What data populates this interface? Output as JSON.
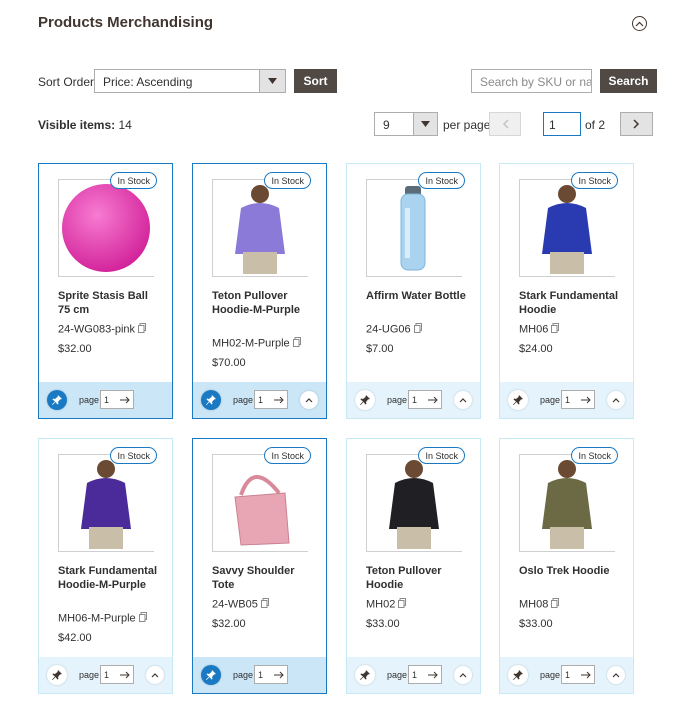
{
  "section": {
    "title": "Products Merchandising"
  },
  "sort": {
    "label": "Sort Order",
    "selected": "Price: Ascending",
    "button": "Sort"
  },
  "search": {
    "placeholder": "Search by SKU or name",
    "button": "Search"
  },
  "visible": {
    "label": "Visible items:",
    "count": "14"
  },
  "pager": {
    "per_page_value": "9",
    "per_page_label": "per page",
    "current": "1",
    "of_label": "of 2"
  },
  "colors": {
    "accent": "#1979c3",
    "dark_button": "#514943",
    "card_footer": "#e5f4fc"
  },
  "products": [
    {
      "stock": "In Stock",
      "name": "Sprite Stasis Ball 75 cm",
      "sku": "24-WG083-pink",
      "price": "$32.00",
      "page_label": "page",
      "page": "1",
      "image": "pink-yoga-ball"
    },
    {
      "stock": "In Stock",
      "name": "Teton Pullover Hoodie-M-Purple",
      "sku": "MH02-M-Purple",
      "price": "$70.00",
      "page_label": "page",
      "page": "1",
      "image": "purple-pullover"
    },
    {
      "stock": "In Stock",
      "name": "Affirm Water Bottle",
      "sku": "24-UG06",
      "price": "$7.00",
      "page_label": "page",
      "page": "1",
      "image": "water-bottle"
    },
    {
      "stock": "In Stock",
      "name": "Stark Fundamental Hoodie",
      "sku": "MH06",
      "price": "$24.00",
      "page_label": "page",
      "page": "1",
      "image": "blue-hoodie"
    },
    {
      "stock": "In Stock",
      "name": "Stark Fundamental Hoodie-M-Purple",
      "sku": "MH06-M-Purple",
      "price": "$42.00",
      "page_label": "page",
      "page": "1",
      "image": "purple-hoodie"
    },
    {
      "stock": "In Stock",
      "name": "Savvy Shoulder Tote",
      "sku": "24-WB05",
      "price": "$32.00",
      "page_label": "page",
      "page": "1",
      "image": "pink-tote"
    },
    {
      "stock": "In Stock",
      "name": "Teton Pullover Hoodie",
      "sku": "MH02",
      "price": "$33.00",
      "page_label": "page",
      "page": "1",
      "image": "black-pullover"
    },
    {
      "stock": "In Stock",
      "name": "Oslo Trek Hoodie",
      "sku": "MH08",
      "price": "$33.00",
      "page_label": "page",
      "page": "1",
      "image": "olive-hoodie"
    }
  ]
}
